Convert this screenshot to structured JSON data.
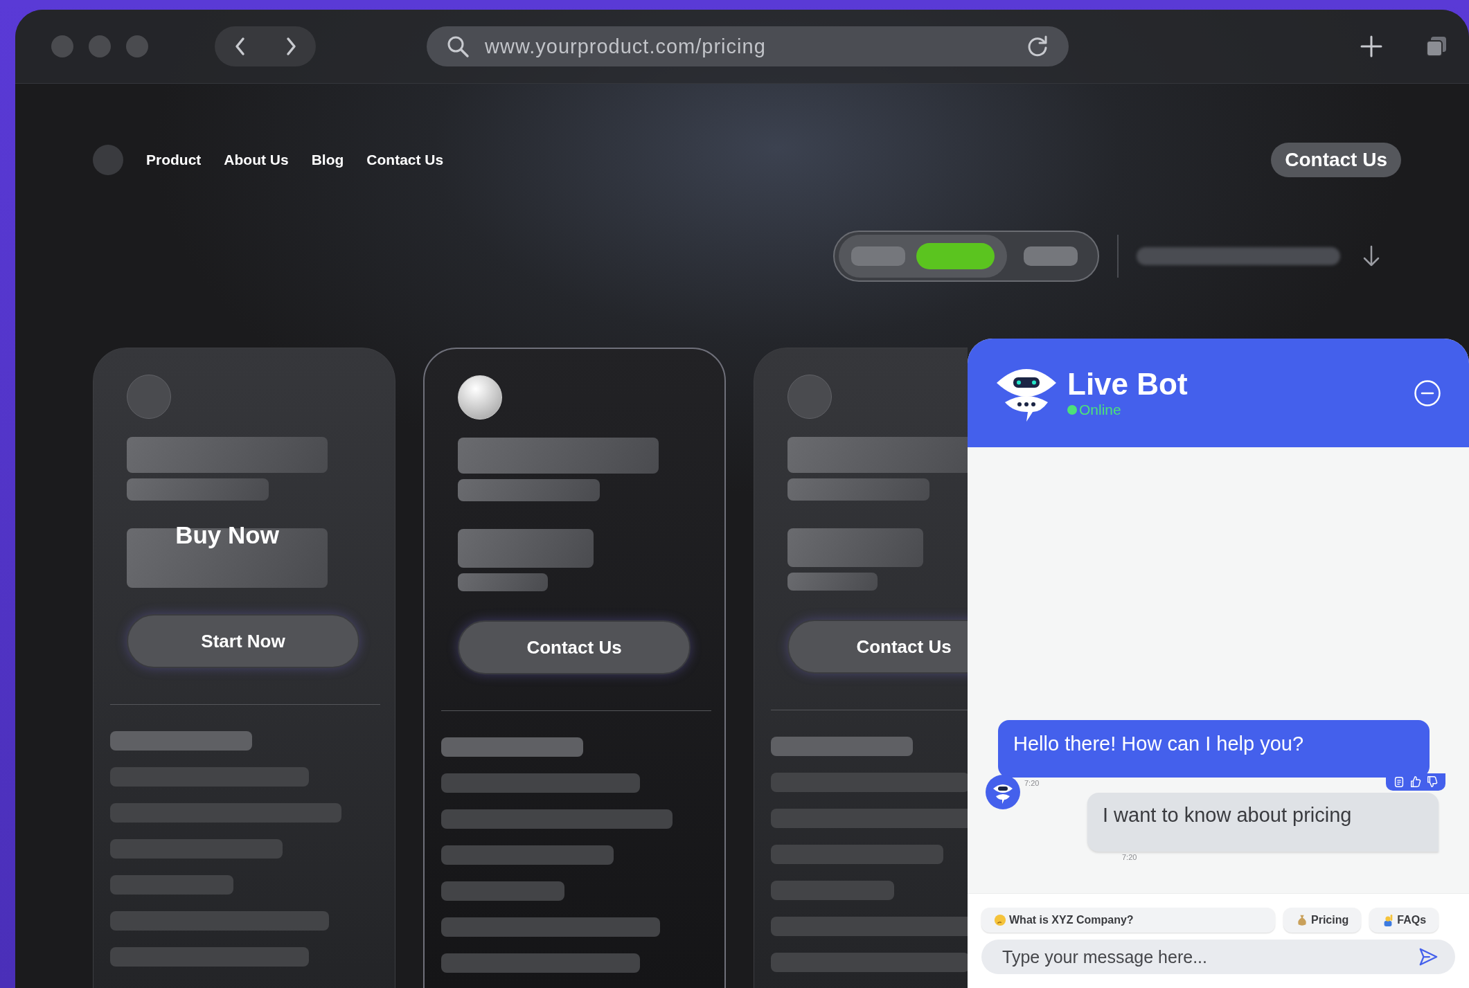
{
  "browser": {
    "url": "www.yourproduct.com/pricing"
  },
  "nav": {
    "links": [
      "Product",
      "About Us",
      "Blog",
      "Contact Us"
    ],
    "cta": "Contact Us"
  },
  "billing_toggle": [
    {
      "selected": false
    },
    {
      "selected": true
    },
    {
      "selected": false
    }
  ],
  "plans": [
    {
      "featured": false,
      "overlay_text": "Buy Now",
      "button": "Start Now"
    },
    {
      "featured": true,
      "button": "Contact Us"
    },
    {
      "featured": false,
      "button": "Contact Us"
    }
  ],
  "chat": {
    "title": "Live Bot",
    "status": "Online",
    "messages": [
      {
        "kind": "bot",
        "text": "Hello there! How can I help you?",
        "time": "7:20"
      },
      {
        "kind": "user",
        "text": "I want to know about pricing",
        "time": "7:20"
      }
    ],
    "quick_replies": [
      {
        "kind": "thinking",
        "label": "What is XYZ Company?"
      },
      {
        "kind": "money",
        "label": "Pricing"
      },
      {
        "kind": "hand",
        "label": "FAQs"
      }
    ],
    "input": {
      "placeholder": "Type your message here..."
    }
  }
}
